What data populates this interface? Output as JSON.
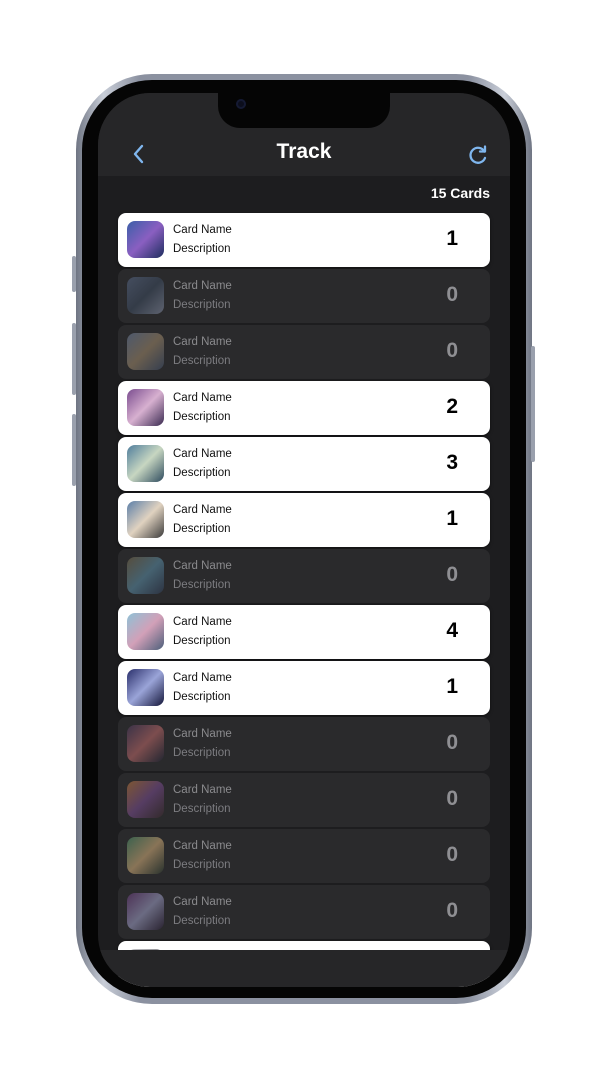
{
  "header": {
    "title": "Track",
    "back_icon": "chevron-left-icon",
    "refresh_icon": "refresh-icon",
    "accent_color": "#7fb6ee"
  },
  "summary": {
    "count_label": "15 Cards"
  },
  "cards": [
    {
      "name": "Card Name",
      "description": "Description",
      "count": "1",
      "owned": true
    },
    {
      "name": "Card Name",
      "description": "Description",
      "count": "0",
      "owned": false
    },
    {
      "name": "Card Name",
      "description": "Description",
      "count": "0",
      "owned": false
    },
    {
      "name": "Card Name",
      "description": "Description",
      "count": "2",
      "owned": true
    },
    {
      "name": "Card Name",
      "description": "Description",
      "count": "3",
      "owned": true
    },
    {
      "name": "Card Name",
      "description": "Description",
      "count": "1",
      "owned": true
    },
    {
      "name": "Card Name",
      "description": "Description",
      "count": "0",
      "owned": false
    },
    {
      "name": "Card Name",
      "description": "Description",
      "count": "4",
      "owned": true
    },
    {
      "name": "Card Name",
      "description": "Description",
      "count": "1",
      "owned": true
    },
    {
      "name": "Card Name",
      "description": "Description",
      "count": "0",
      "owned": false
    },
    {
      "name": "Card Name",
      "description": "Description",
      "count": "0",
      "owned": false
    },
    {
      "name": "Card Name",
      "description": "Description",
      "count": "0",
      "owned": false
    },
    {
      "name": "Card Name",
      "description": "Description",
      "count": "0",
      "owned": false
    },
    {
      "name": "",
      "description": "",
      "count": "",
      "owned": true
    }
  ],
  "colors": {
    "owned_row": "#ffffff",
    "unowned_row": "#2a2a2c",
    "screen_bg": "#1d1d1f",
    "nav_bg": "#262628"
  }
}
